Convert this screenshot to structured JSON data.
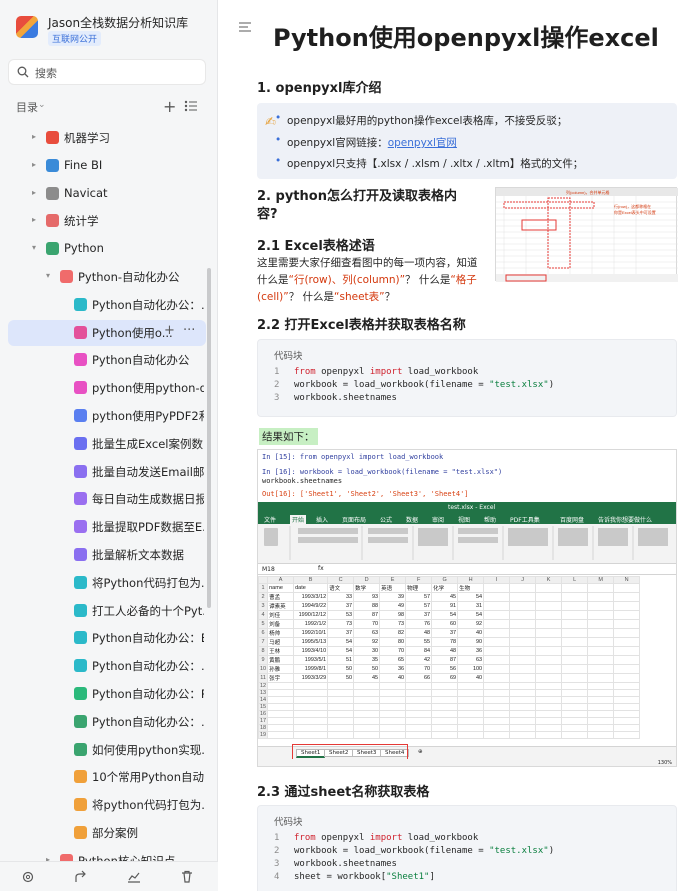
{
  "kb": {
    "title": "Jason全栈数据分析知识库",
    "badge": "互联网公开"
  },
  "search": {
    "placeholder": "搜索"
  },
  "toc": {
    "label": "目录"
  },
  "tree": [
    {
      "label": "机器学习",
      "color": "#e84d3d"
    },
    {
      "label": "Fine BI",
      "color": "#3a8bd8"
    },
    {
      "label": "Navicat",
      "color": "#8c8c8c"
    },
    {
      "label": "统计学",
      "color": "#e56a6a"
    },
    {
      "label": "Python",
      "color": "#3aa46f"
    },
    {
      "label": "Python-自动化办公",
      "color": "#f06b6b"
    },
    {
      "label": "Python自动化办公：…",
      "color": "#2bb9c9"
    },
    {
      "label": "Python使用o...",
      "color": "#e3519b"
    },
    {
      "label": "Python自动化办公",
      "color": "#e851c3"
    },
    {
      "label": "python使用python-do...",
      "color": "#e851c3"
    },
    {
      "label": "python使用PyPDF2和...",
      "color": "#5a7ff0"
    },
    {
      "label": "批量生成Excel案例数...",
      "color": "#6a6ff0"
    },
    {
      "label": "批量自动发送Email邮件",
      "color": "#8a6ff0"
    },
    {
      "label": "每日自动生成数据日报",
      "color": "#9a6ff0"
    },
    {
      "label": "批量提取PDF数据至E...",
      "color": "#9a6ff0"
    },
    {
      "label": "批量解析文本数据",
      "color": "#8a6ff0"
    },
    {
      "label": "将Python代码打包为...",
      "color": "#2bb9c9"
    },
    {
      "label": "打工人必备的十个Pyt...",
      "color": "#2bb9c9"
    },
    {
      "label": "Python自动化办公：E...",
      "color": "#2bb9c9"
    },
    {
      "label": "Python自动化办公：…",
      "color": "#2bb9c9"
    },
    {
      "label": "Python自动化办公：P...",
      "color": "#2bb97b"
    },
    {
      "label": "Python自动化办公：…",
      "color": "#3aa46f"
    },
    {
      "label": "如何使用python实现...",
      "color": "#3aa46f"
    },
    {
      "label": "10个常用Python自动...",
      "color": "#f0a03a"
    },
    {
      "label": "将python代码打包为....",
      "color": "#f0a03a"
    },
    {
      "label": "部分案例",
      "color": "#f0a03a"
    },
    {
      "label": "Python核心知识点",
      "color": "#f06b6b"
    }
  ],
  "doc": {
    "title": "Python使用openpyxl操作excel",
    "h1": "1. openpyxl库介绍",
    "callout": [
      "openpyxl最好用的python操作excel表格库，不接受反驳；",
      "openpyxl官网链接：",
      "openpyxl官网",
      "openpyxl只支持【.xlsx / .xlsm / .xltx / .xltm】格式的文件；"
    ],
    "h2": "2. python怎么打开及读取表格内容?",
    "h21": "2.1 Excel表格述语",
    "p21a": "这里需要大家仔细查看图中的每一项内容，知道",
    "p21b_pre": "什么是",
    "p21b_red": "“行(row)、列(column)”",
    "p21b_mid": "？ 什么是",
    "p21b_red2": "“格子",
    "p21c_red": "(cell)”",
    "p21c_mid": "？ 什么是",
    "p21c_red2": "“sheet表”",
    "p21c_end": "？",
    "h22": "2.2 打开Excel表格并获取表格名称",
    "code_caption": "代码块",
    "code1": [
      "from openpyxl import load_workbook",
      "workbook = load_workbook(filename = \"test.xlsx\")",
      "workbook.sheetnames"
    ],
    "result_label": "结果如下：",
    "nb_lines": [
      "In [15]: from openpyxl import load_workbook",
      "In [16]: workbook = load_workbook(filename = \"test.xlsx\")",
      "         workbook.sheetnames",
      "Out[16]: ['Sheet1', 'Sheet2', 'Sheet3', 'Sheet4']"
    ],
    "h23": "2.3 通过sheet名称获取表格",
    "code2": [
      "from openpyxl import load_workbook",
      "workbook = load_workbook(filename = \"test.xlsx\")",
      "workbook.sheetnames",
      "sheet = workbook[\"Sheet1\"]"
    ]
  },
  "excel": {
    "title": "test.xlsx - Excel",
    "tabs": [
      "文件",
      "开始",
      "插入",
      "页面布局",
      "公式",
      "数据",
      "审阅",
      "视图",
      "帮助",
      "PDF工具集",
      "百度网盘",
      "告诉我你想要做什么"
    ],
    "namebox": "M18",
    "cols": [
      "A",
      "B",
      "C",
      "D",
      "E",
      "F",
      "G",
      "H",
      "I",
      "J",
      "K",
      "L",
      "M",
      "N"
    ],
    "headers": [
      "name",
      "date",
      "语文",
      "数学",
      "英语",
      "物理",
      "化学",
      "生物"
    ],
    "rows": [
      [
        "曹孟",
        "1993/3/12",
        "33",
        "93",
        "39",
        "57",
        "45",
        "54"
      ],
      [
        "谭素英",
        "1994/9/22",
        "37",
        "88",
        "49",
        "57",
        "91",
        "31"
      ],
      [
        "刘佳",
        "1990/12/12",
        "53",
        "87",
        "98",
        "37",
        "54",
        "54"
      ],
      [
        "刘备",
        "1992/1/2",
        "73",
        "70",
        "73",
        "76",
        "60",
        "92"
      ],
      [
        "杨帅",
        "1992/10/1",
        "37",
        "63",
        "82",
        "48",
        "37",
        "40"
      ],
      [
        "马超",
        "1995/5/13",
        "54",
        "92",
        "80",
        "55",
        "78",
        "90"
      ],
      [
        "王林",
        "1993/4/10",
        "54",
        "30",
        "70",
        "84",
        "48",
        "36"
      ],
      [
        "黄鹏",
        "1993/5/1",
        "51",
        "35",
        "65",
        "42",
        "87",
        "63"
      ],
      [
        "孙雅",
        "1999/8/1",
        "50",
        "50",
        "36",
        "70",
        "56",
        "100"
      ],
      [
        "张宇",
        "1993/3/29",
        "50",
        "45",
        "40",
        "66",
        "69",
        "40"
      ]
    ],
    "sheets": [
      "Sheet1",
      "Sheet2",
      "Sheet3",
      "Sheet4"
    ],
    "zoom": "130%"
  }
}
